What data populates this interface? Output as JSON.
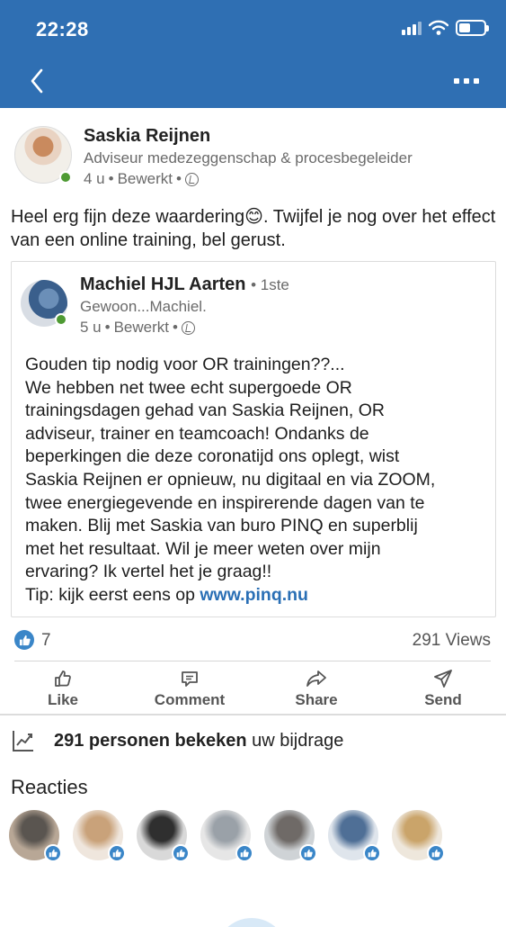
{
  "status_bar": {
    "time": "22:28"
  },
  "post": {
    "author": {
      "name": "Saskia Reijnen",
      "headline": "Adviseur medezeggenschap & procesbegeleider",
      "time": "4 u",
      "edited": "Bewerkt",
      "separator": "•"
    },
    "text_before_emoji": "Heel erg fijn deze waardering",
    "emoji": "😊",
    "text_after_emoji": ". Twijfel je nog over het effect van een online training, bel gerust."
  },
  "shared": {
    "author": {
      "name": "Machiel HJL Aarten",
      "degree": "• 1ste",
      "headline": "Gewoon...Machiel.",
      "time": "5 u",
      "edited": "Bewerkt",
      "separator": "•"
    },
    "lines": [
      "Gouden tip nodig voor OR trainingen??...",
      "We hebben net twee echt supergoede OR",
      "trainingsdagen gehad van Saskia Reijnen, OR",
      "adviseur, trainer en teamcoach! Ondanks de",
      "beperkingen die deze coronatijd ons oplegt, wist",
      "Saskia Reijnen er opnieuw, nu digitaal en via ZOOM,",
      "twee energiegevende en inspirerende dagen van te",
      "maken. Blij met Saskia van buro PINQ en superblij",
      "met het resultaat. Wil je meer weten over mijn",
      "ervaring? Ik vertel het je graag!!"
    ],
    "tip_prefix": "Tip: kijk eerst eens op ",
    "tip_link": "www.pinq.nu"
  },
  "stats": {
    "likes": "7",
    "views": "291 Views"
  },
  "actions": {
    "like": "Like",
    "comment": "Comment",
    "share": "Share",
    "send": "Send"
  },
  "analytics": {
    "bold": "291 personen bekeken",
    "rest": " uw bijdrage"
  },
  "reactions": {
    "title": "Reacties",
    "avatars": [
      {
        "name": "reactor-1",
        "colors": [
          "#5a5550",
          "#b8a796"
        ]
      },
      {
        "name": "reactor-2",
        "colors": [
          "#c9a27a",
          "#efe6dd"
        ]
      },
      {
        "name": "reactor-3",
        "colors": [
          "#2f2f2f",
          "#d9d9d9"
        ]
      },
      {
        "name": "reactor-4",
        "colors": [
          "#9aa1a8",
          "#e6e6e6"
        ]
      },
      {
        "name": "reactor-5",
        "colors": [
          "#6f6a67",
          "#cfd3d6"
        ]
      },
      {
        "name": "reactor-6",
        "colors": [
          "#4f6f96",
          "#dfe5ec"
        ]
      },
      {
        "name": "reactor-7",
        "colors": [
          "#caa46a",
          "#eee7dc"
        ]
      }
    ]
  },
  "colors": {
    "topbar": "#2f6fb3",
    "link": "#2a6fb5",
    "online": "#4e9a33",
    "like": "#3a86c8"
  }
}
